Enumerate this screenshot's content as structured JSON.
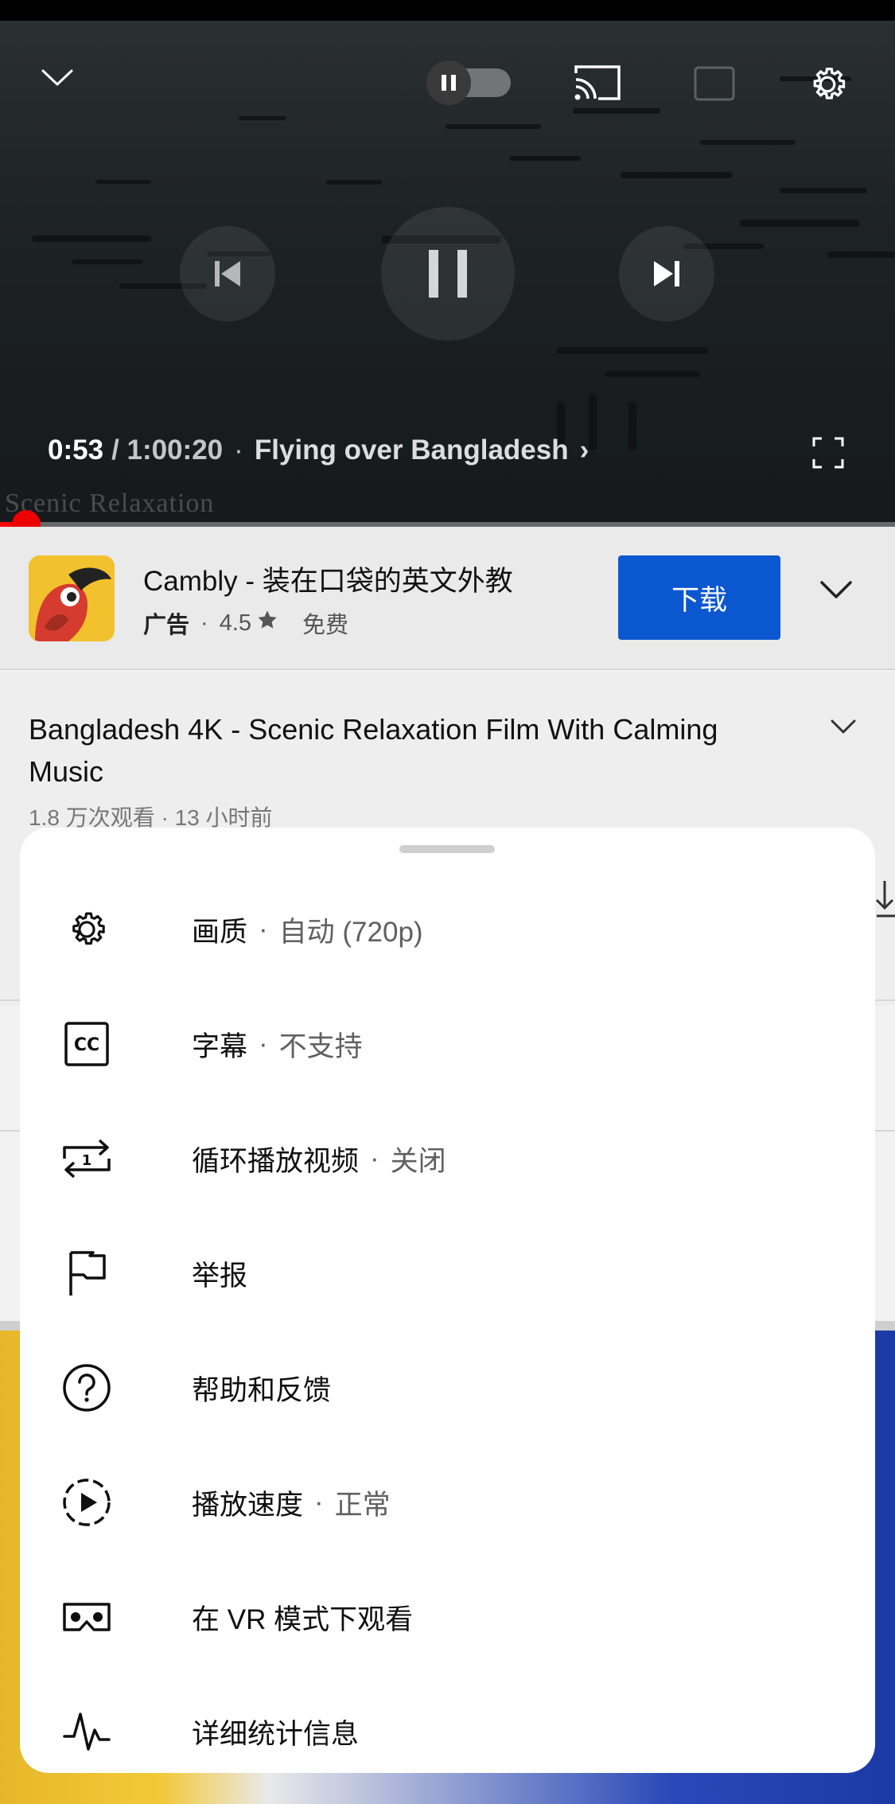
{
  "player": {
    "current_time": "0:53",
    "total_time": "/ 1:00:20",
    "separator": "·",
    "video_title": "Flying over Bangladesh",
    "title_chevron": "›",
    "watermark": "Scenic Relaxation",
    "progress_fraction": 0.015
  },
  "ad": {
    "title": "Cambly - 装在口袋的英文外教",
    "label": "广告",
    "dot": "·",
    "rating": "4.5",
    "price": "免费",
    "button_label": "下载"
  },
  "video": {
    "title": "Bangladesh 4K - Scenic Relaxation Film With Calming Music",
    "meta": "1.8 万次观看 · 13 小时前"
  },
  "menu": {
    "items": [
      {
        "label": "画质",
        "sep": "·",
        "value": "自动 (720p)",
        "icon": "gear-icon"
      },
      {
        "label": "字幕",
        "sep": "·",
        "value": "不支持",
        "icon": "captions-icon"
      },
      {
        "label": "循环播放视频",
        "sep": "·",
        "value": "关闭",
        "icon": "loop-icon"
      },
      {
        "label": "举报",
        "icon": "flag-icon"
      },
      {
        "label": "帮助和反馈",
        "icon": "help-icon"
      },
      {
        "label": "播放速度",
        "sep": "·",
        "value": "正常",
        "icon": "playback-speed-icon"
      },
      {
        "label": "在 VR 模式下观看",
        "icon": "vr-icon"
      },
      {
        "label": "详细统计信息",
        "icon": "stats-icon"
      }
    ]
  },
  "colors": {
    "progress": "#ff0000",
    "ad_button": "#0b57d0",
    "sheet_bg": "#ffffff"
  }
}
